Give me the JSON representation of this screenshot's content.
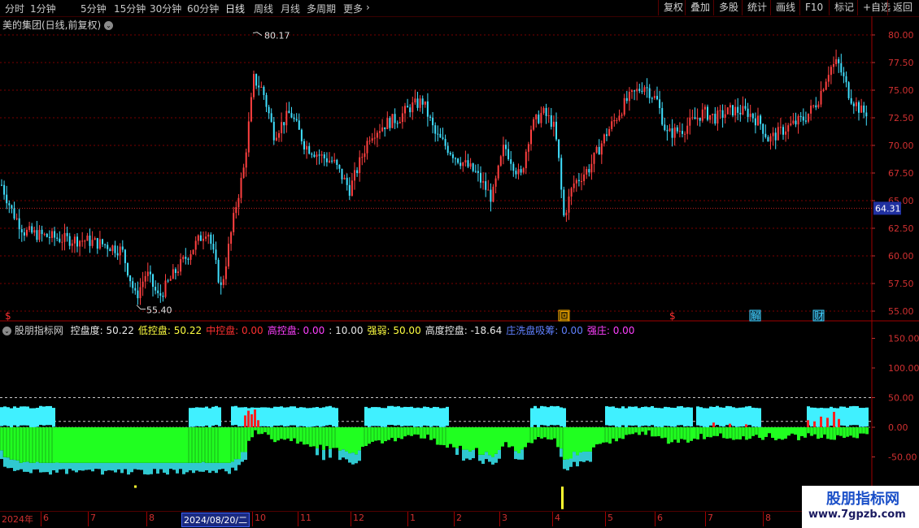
{
  "toolbar": {
    "periods": [
      "分时",
      "1分钟",
      "5分钟",
      "15分钟",
      "30分钟",
      "60分钟",
      "日线",
      "周线",
      "月线",
      "多周期",
      "更多"
    ],
    "active_period": "日线",
    "tools": [
      "复权",
      "叠加",
      "多股",
      "统计",
      "画线",
      "F10",
      "标记",
      "+自选",
      "返回"
    ]
  },
  "stock": {
    "title": "美的集团(日线,前复权)",
    "high_label": "80.17",
    "low_label": "55.40",
    "current_price": "64.31"
  },
  "price_axis": [
    "80.00",
    "77.50",
    "75.00",
    "72.50",
    "70.00",
    "67.50",
    "65.00",
    "62.50",
    "60.00",
    "57.50",
    "55.00"
  ],
  "event_markers": [
    {
      "label": "$",
      "color": "#ff3030"
    },
    {
      "label": "回",
      "color": "#ffb000"
    },
    {
      "label": "$",
      "color": "#ff3030"
    },
    {
      "label": "解",
      "color": "#40d0ff"
    },
    {
      "label": "财",
      "color": "#40d0ff"
    }
  ],
  "indicator": {
    "name": "股朋指标网",
    "fields": [
      {
        "label": "控盘度: ",
        "value": "50.22",
        "color": "#e8e8e8"
      },
      {
        "label": "低控盘: ",
        "value": "50.22",
        "color": "#ffff40"
      },
      {
        "label": "中控盘: ",
        "value": "0.00",
        "color": "#ff3030"
      },
      {
        "label": "高控盘: ",
        "value": "0.00",
        "color": "#ff40ff"
      },
      {
        "label": ": ",
        "value": "10.00",
        "color": "#e8e8e8"
      },
      {
        "label": "强弱: ",
        "value": "50.00",
        "color": "#ffff40"
      },
      {
        "label": "高度控盘: ",
        "value": "-18.64",
        "color": "#e8e8e8"
      },
      {
        "label": "庄洗盘吸筹: ",
        "value": "0.00",
        "color": "#6080ff"
      },
      {
        "label": "强庄: ",
        "value": "0.00",
        "color": "#ff40ff"
      }
    ],
    "axis": [
      "150.00",
      "100.00",
      "50.00",
      "0.00",
      "-50.00"
    ]
  },
  "date_axis": {
    "labels": [
      "2024年",
      "6",
      "7",
      "8",
      "10",
      "11",
      "12",
      "1",
      "2",
      "3",
      "4",
      "5",
      "6",
      "7",
      "8"
    ],
    "selected": "2024/08/20/二"
  },
  "watermark": {
    "title": "股朋指标网",
    "url": "www.7gpzb.com"
  },
  "colors": {
    "up": "#ff4040",
    "down": "#40e0ff",
    "grid": "#7a0000",
    "cyan_bar": "#40f0ff",
    "green_bar": "#20ff20",
    "red_bar": "#ff2020"
  }
}
